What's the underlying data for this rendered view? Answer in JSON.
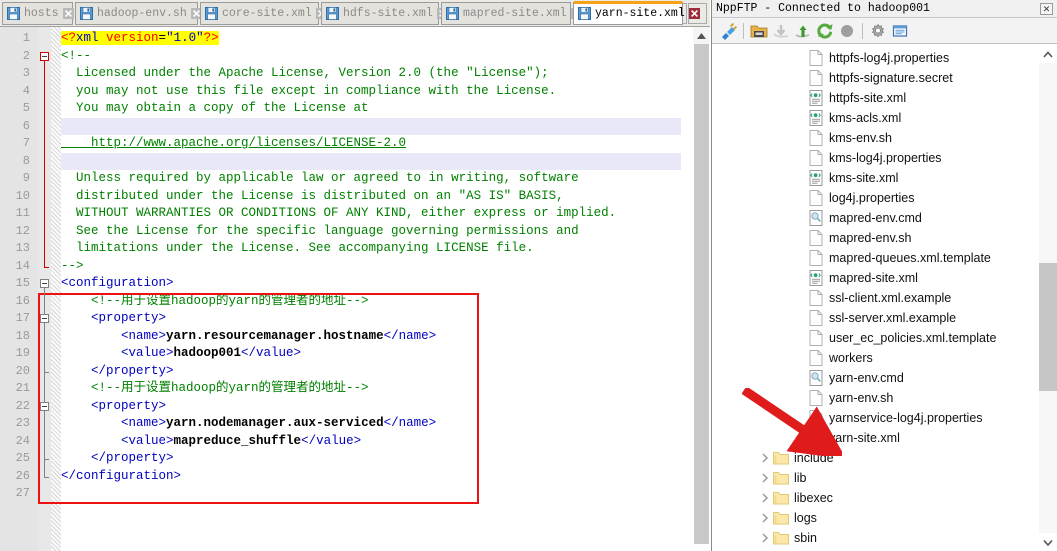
{
  "window": {
    "editor_tabs": [
      {
        "label": "hosts",
        "active": false,
        "icon": "file-save-icon"
      },
      {
        "label": "hadoop-env.sh",
        "active": false,
        "icon": "file-save-icon"
      },
      {
        "label": "core-site.xml",
        "active": false,
        "icon": "file-save-icon"
      },
      {
        "label": "hdfs-site.xml",
        "active": false,
        "icon": "file-save-icon"
      },
      {
        "label": "mapred-site.xml",
        "active": false,
        "icon": "file-save-icon"
      },
      {
        "label": "yarn-site.xml",
        "active": true,
        "icon": "file-save-icon"
      }
    ],
    "tab_nav": {
      "prev": "◄",
      "next": "►"
    }
  },
  "editor": {
    "line_numbers": [
      1,
      2,
      3,
      4,
      5,
      6,
      7,
      8,
      9,
      10,
      11,
      12,
      13,
      14,
      15,
      16,
      17,
      18,
      19,
      20,
      21,
      22,
      23,
      24,
      25,
      26,
      27
    ],
    "current_line": 6,
    "lines": [
      {
        "n": 1,
        "text": "<?xml version=\"1.0\"?>"
      },
      {
        "n": 2,
        "text": "<!--"
      },
      {
        "n": 3,
        "text": "  Licensed under the Apache License, Version 2.0 (the \"License\");"
      },
      {
        "n": 4,
        "text": "  you may not use this file except in compliance with the License."
      },
      {
        "n": 5,
        "text": "  You may obtain a copy of the License at"
      },
      {
        "n": 6,
        "text": ""
      },
      {
        "n": 7,
        "text": "    http://www.apache.org/licenses/LICENSE-2.0"
      },
      {
        "n": 8,
        "text": ""
      },
      {
        "n": 9,
        "text": "  Unless required by applicable law or agreed to in writing, software"
      },
      {
        "n": 10,
        "text": "  distributed under the License is distributed on an \"AS IS\" BASIS,"
      },
      {
        "n": 11,
        "text": "  WITHOUT WARRANTIES OR CONDITIONS OF ANY KIND, either express or implied."
      },
      {
        "n": 12,
        "text": "  See the License for the specific language governing permissions and"
      },
      {
        "n": 13,
        "text": "  limitations under the License. See accompanying LICENSE file."
      },
      {
        "n": 14,
        "text": "-->"
      },
      {
        "n": 15,
        "text": "<configuration>"
      },
      {
        "n": 16,
        "text": "    <!--用于设置hadoop的yarn的管理者的地址-->"
      },
      {
        "n": 17,
        "text": "    <property>"
      },
      {
        "n": 18,
        "text": "        <name>yarn.resourcemanager.hostname</name>"
      },
      {
        "n": 19,
        "text": "        <value>hadoop001</value>"
      },
      {
        "n": 20,
        "text": "    </property>"
      },
      {
        "n": 21,
        "text": "    <!--用于设置hadoop的yarn的管理者的地址-->"
      },
      {
        "n": 22,
        "text": "    <property>"
      },
      {
        "n": 23,
        "text": "        <name>yarn.nodemanager.aux-serviced</name>"
      },
      {
        "n": 24,
        "text": "        <value>mapreduce_shuffle</value>"
      },
      {
        "n": 25,
        "text": "    </property>"
      },
      {
        "n": 26,
        "text": "</configuration>"
      },
      {
        "n": 27,
        "text": ""
      }
    ],
    "tokens": {
      "xml_decl_open": "<?",
      "xml_decl_name": "xml",
      "xml_decl_attr": " version",
      "xml_decl_eq": "=",
      "xml_decl_val": "\"1.0\"",
      "xml_decl_close": "?>",
      "comment_open": "<!--",
      "comment_close": "-->",
      "license_l3": "  Licensed under the Apache License, Version 2.0 (the \"License\");",
      "license_l4": "  you may not use this file except in compliance with the License.",
      "license_l5": "  You may obtain a copy of the License at",
      "license_url": "    http://www.apache.org/licenses/LICENSE-2.0",
      "license_l9": "  Unless required by applicable law or agreed to in writing, software",
      "license_l10": "  distributed under the License is distributed on an \"AS IS\" BASIS,",
      "license_l11": "  WITHOUT WARRANTIES OR CONDITIONS OF ANY KIND, either express or implied.",
      "license_l12": "  See the License for the specific language governing permissions and",
      "license_l13": "  limitations under the License. See accompanying LICENSE file.",
      "cfg_open": "<configuration>",
      "cfg_close": "</configuration>",
      "cn_comment": "<!--用于设置hadoop的yarn的管理者的地址-->",
      "prop_open": "<property>",
      "prop_close": "</property>",
      "name_open": "<name>",
      "name_close": "</name>",
      "value_open": "<value>",
      "value_close": "</value>",
      "name1": "yarn.resourcemanager.hostname",
      "value1": "hadoop001",
      "name2": "yarn.nodemanager.aux-serviced",
      "value2": "mapreduce_shuffle"
    }
  },
  "ftp": {
    "title": "NppFTP - Connected to hadoop001",
    "close_label": "✕",
    "toolbar": [
      {
        "name": "connect-icon",
        "enabled": true
      },
      {
        "name": "open-dir-icon",
        "enabled": true
      },
      {
        "name": "download-icon",
        "enabled": false
      },
      {
        "name": "upload-icon",
        "enabled": true
      },
      {
        "name": "refresh-icon",
        "enabled": true
      },
      {
        "name": "abort-icon",
        "enabled": true
      },
      {
        "name": "settings-gear-icon",
        "enabled": true
      },
      {
        "name": "messages-icon",
        "enabled": true
      }
    ],
    "items": [
      {
        "name": "httpfs-log4j.properties",
        "type": "file",
        "icon": "file-icon"
      },
      {
        "name": "httpfs-signature.secret",
        "type": "file",
        "icon": "file-icon"
      },
      {
        "name": "httpfs-site.xml",
        "type": "file",
        "icon": "xml-file-icon"
      },
      {
        "name": "kms-acls.xml",
        "type": "file",
        "icon": "xml-file-icon"
      },
      {
        "name": "kms-env.sh",
        "type": "file",
        "icon": "file-icon"
      },
      {
        "name": "kms-log4j.properties",
        "type": "file",
        "icon": "file-icon"
      },
      {
        "name": "kms-site.xml",
        "type": "file",
        "icon": "xml-file-icon"
      },
      {
        "name": "log4j.properties",
        "type": "file",
        "icon": "file-icon"
      },
      {
        "name": "mapred-env.cmd",
        "type": "file",
        "icon": "cmd-file-icon"
      },
      {
        "name": "mapred-env.sh",
        "type": "file",
        "icon": "file-icon"
      },
      {
        "name": "mapred-queues.xml.template",
        "type": "file",
        "icon": "file-icon"
      },
      {
        "name": "mapred-site.xml",
        "type": "file",
        "icon": "xml-file-icon"
      },
      {
        "name": "ssl-client.xml.example",
        "type": "file",
        "icon": "file-icon"
      },
      {
        "name": "ssl-server.xml.example",
        "type": "file",
        "icon": "file-icon"
      },
      {
        "name": "user_ec_policies.xml.template",
        "type": "file",
        "icon": "file-icon"
      },
      {
        "name": "workers",
        "type": "file",
        "icon": "file-icon"
      },
      {
        "name": "yarn-env.cmd",
        "type": "file",
        "icon": "cmd-file-icon"
      },
      {
        "name": "yarn-env.sh",
        "type": "file",
        "icon": "file-icon"
      },
      {
        "name": "yarnservice-log4j.properties",
        "type": "file",
        "icon": "file-icon"
      },
      {
        "name": "yarn-site.xml",
        "type": "file",
        "icon": "xml-file-icon"
      },
      {
        "name": "include",
        "type": "folder",
        "icon": "folder-icon"
      },
      {
        "name": "lib",
        "type": "folder",
        "icon": "folder-icon"
      },
      {
        "name": "libexec",
        "type": "folder",
        "icon": "folder-icon"
      },
      {
        "name": "logs",
        "type": "folder",
        "icon": "folder-icon"
      },
      {
        "name": "sbin",
        "type": "folder",
        "icon": "folder-icon"
      }
    ]
  },
  "annotations": {
    "config_rect_color": "#ee1111",
    "arrow_color": "#e01b1b",
    "arrow_target": "yarn-site.xml"
  }
}
